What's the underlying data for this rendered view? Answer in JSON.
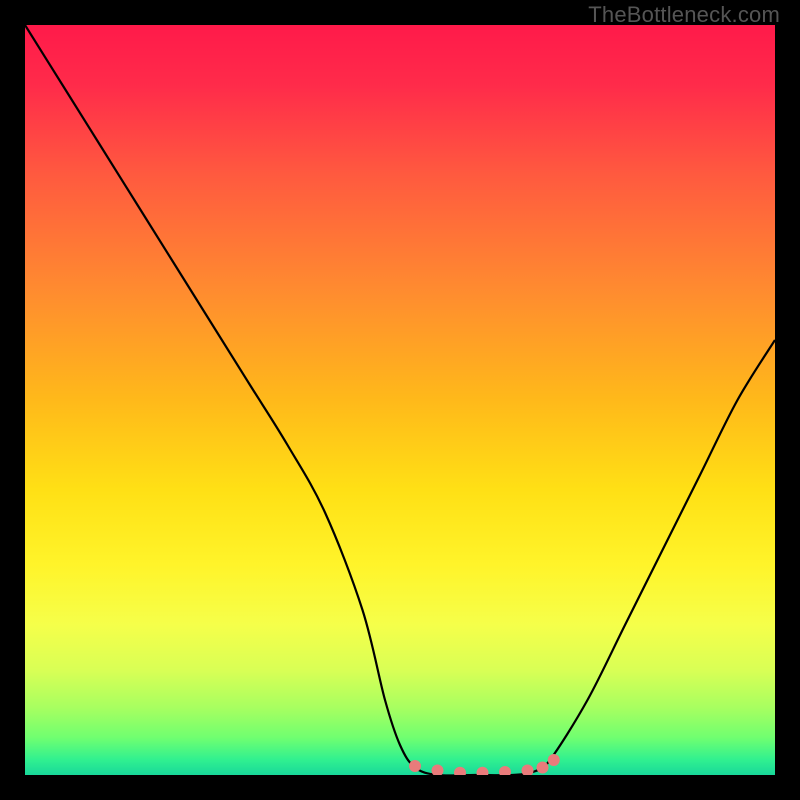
{
  "watermark": "TheBottleneck.com",
  "chart_data": {
    "type": "line",
    "title": "",
    "xlabel": "",
    "ylabel": "",
    "xlim": [
      0,
      100
    ],
    "ylim": [
      0,
      100
    ],
    "series": [
      {
        "name": "curve",
        "x": [
          0,
          5,
          10,
          15,
          20,
          25,
          30,
          35,
          40,
          45,
          48,
          50,
          52,
          55,
          60,
          65,
          68,
          70,
          75,
          80,
          85,
          90,
          95,
          100
        ],
        "y": [
          100,
          92,
          84,
          76,
          68,
          60,
          52,
          44,
          35,
          22,
          10,
          4,
          1,
          0,
          0,
          0,
          0.5,
          2,
          10,
          20,
          30,
          40,
          50,
          58
        ]
      }
    ],
    "markers": {
      "name": "flat-region-dots",
      "color": "#e97b7b",
      "x": [
        52,
        55,
        58,
        61,
        64,
        67,
        69,
        70.5
      ],
      "y": [
        1.2,
        0.6,
        0.3,
        0.3,
        0.4,
        0.6,
        1.0,
        2.0
      ]
    },
    "gradient_stops": [
      {
        "offset": 0.0,
        "color": "#ff1a4a"
      },
      {
        "offset": 0.08,
        "color": "#ff2b4a"
      },
      {
        "offset": 0.2,
        "color": "#ff5a3f"
      },
      {
        "offset": 0.35,
        "color": "#ff8a30"
      },
      {
        "offset": 0.5,
        "color": "#ffb91a"
      },
      {
        "offset": 0.62,
        "color": "#ffe015"
      },
      {
        "offset": 0.72,
        "color": "#fff42a"
      },
      {
        "offset": 0.8,
        "color": "#f5ff4a"
      },
      {
        "offset": 0.86,
        "color": "#d9ff55"
      },
      {
        "offset": 0.91,
        "color": "#a8ff60"
      },
      {
        "offset": 0.95,
        "color": "#70ff70"
      },
      {
        "offset": 0.98,
        "color": "#30f090"
      },
      {
        "offset": 1.0,
        "color": "#18d89a"
      }
    ]
  }
}
